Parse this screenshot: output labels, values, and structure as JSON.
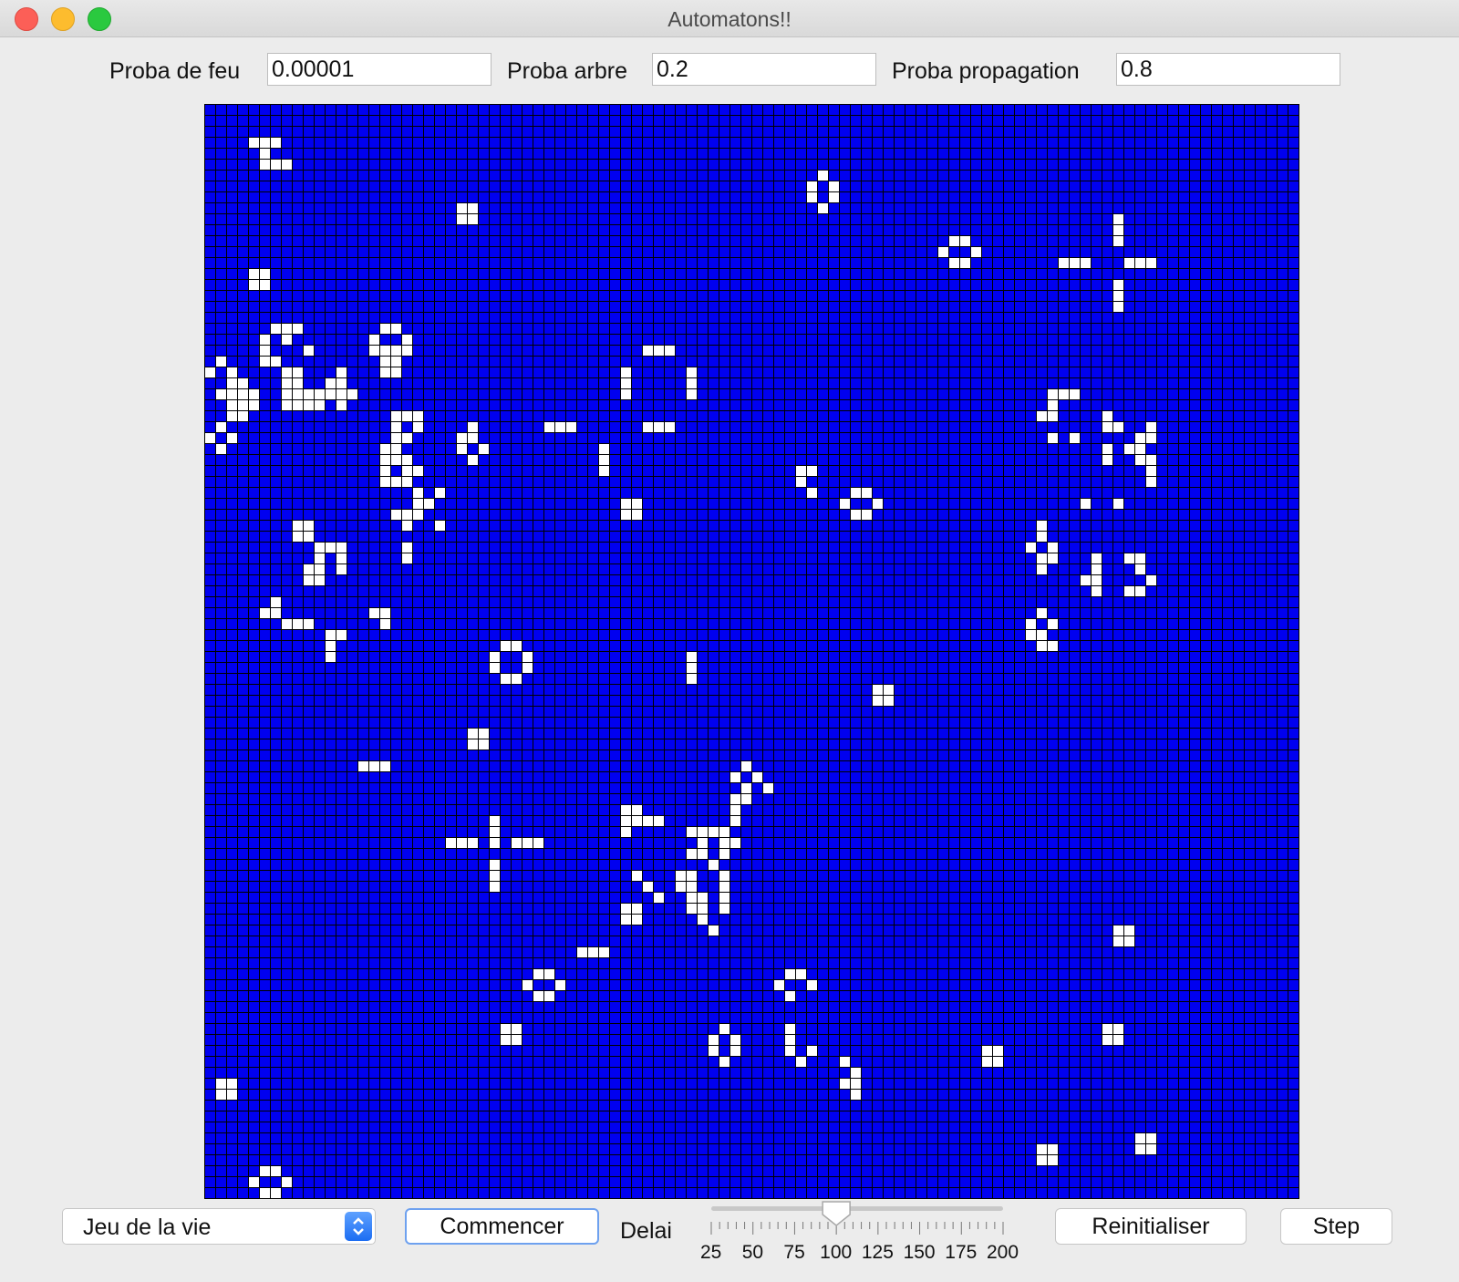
{
  "window": {
    "title": "Automatons!!"
  },
  "params": {
    "fire": {
      "label": "Proba de feu",
      "value": "0.00001"
    },
    "tree": {
      "label": "Proba arbre",
      "value": "0.2"
    },
    "spread": {
      "label": "Proba propagation",
      "value": "0.8"
    }
  },
  "grid": {
    "rows": 100,
    "cols": 100,
    "background_color": "#0000f0",
    "cell_color": "#ffffff",
    "line_color": "#000000",
    "alive_cells": [
      [
        3,
        4
      ],
      [
        3,
        5
      ],
      [
        3,
        6
      ],
      [
        4,
        5
      ],
      [
        5,
        5
      ],
      [
        5,
        6
      ],
      [
        5,
        7
      ],
      [
        6,
        56
      ],
      [
        7,
        55
      ],
      [
        7,
        57
      ],
      [
        8,
        55
      ],
      [
        8,
        57
      ],
      [
        9,
        56
      ],
      [
        9,
        23
      ],
      [
        9,
        24
      ],
      [
        10,
        23
      ],
      [
        10,
        24
      ],
      [
        10,
        83
      ],
      [
        11,
        83
      ],
      [
        12,
        83
      ],
      [
        12,
        68
      ],
      [
        12,
        69
      ],
      [
        13,
        67
      ],
      [
        13,
        70
      ],
      [
        14,
        68
      ],
      [
        14,
        69
      ],
      [
        14,
        78
      ],
      [
        14,
        79
      ],
      [
        14,
        80
      ],
      [
        14,
        84
      ],
      [
        14,
        85
      ],
      [
        14,
        86
      ],
      [
        15,
        4
      ],
      [
        15,
        5
      ],
      [
        16,
        4
      ],
      [
        16,
        5
      ],
      [
        16,
        83
      ],
      [
        17,
        83
      ],
      [
        18,
        83
      ],
      [
        20,
        6
      ],
      [
        20,
        7
      ],
      [
        20,
        8
      ],
      [
        21,
        5
      ],
      [
        21,
        7
      ],
      [
        22,
        5
      ],
      [
        22,
        9
      ],
      [
        23,
        5
      ],
      [
        23,
        6
      ],
      [
        20,
        16
      ],
      [
        20,
        17
      ],
      [
        21,
        15
      ],
      [
        21,
        18
      ],
      [
        22,
        15
      ],
      [
        22,
        16
      ],
      [
        22,
        17
      ],
      [
        22,
        18
      ],
      [
        23,
        16
      ],
      [
        23,
        17
      ],
      [
        24,
        16
      ],
      [
        24,
        17
      ],
      [
        22,
        40
      ],
      [
        22,
        41
      ],
      [
        22,
        42
      ],
      [
        24,
        7
      ],
      [
        24,
        8
      ],
      [
        25,
        7
      ],
      [
        25,
        8
      ],
      [
        25,
        11
      ],
      [
        26,
        7
      ],
      [
        26,
        8
      ],
      [
        26,
        9
      ],
      [
        26,
        10
      ],
      [
        26,
        11
      ],
      [
        26,
        12
      ],
      [
        26,
        13
      ],
      [
        25,
        12
      ],
      [
        24,
        12
      ],
      [
        27,
        7
      ],
      [
        27,
        8
      ],
      [
        27,
        9
      ],
      [
        27,
        10
      ],
      [
        27,
        12
      ],
      [
        23,
        1
      ],
      [
        24,
        0
      ],
      [
        24,
        2
      ],
      [
        25,
        2
      ],
      [
        25,
        3
      ],
      [
        26,
        1
      ],
      [
        26,
        2
      ],
      [
        26,
        3
      ],
      [
        26,
        4
      ],
      [
        27,
        2
      ],
      [
        27,
        3
      ],
      [
        27,
        4
      ],
      [
        28,
        2
      ],
      [
        28,
        3
      ],
      [
        29,
        1
      ],
      [
        30,
        0
      ],
      [
        30,
        2
      ],
      [
        31,
        1
      ],
      [
        24,
        38
      ],
      [
        25,
        38
      ],
      [
        26,
        38
      ],
      [
        24,
        44
      ],
      [
        25,
        44
      ],
      [
        26,
        44
      ],
      [
        26,
        77
      ],
      [
        26,
        78
      ],
      [
        26,
        79
      ],
      [
        27,
        77
      ],
      [
        28,
        76
      ],
      [
        28,
        77
      ],
      [
        28,
        82
      ],
      [
        29,
        82
      ],
      [
        29,
        83
      ],
      [
        29,
        40
      ],
      [
        29,
        41
      ],
      [
        29,
        42
      ],
      [
        28,
        17
      ],
      [
        28,
        18
      ],
      [
        28,
        19
      ],
      [
        29,
        17
      ],
      [
        29,
        19
      ],
      [
        30,
        17
      ],
      [
        30,
        18
      ],
      [
        31,
        16
      ],
      [
        31,
        17
      ],
      [
        32,
        16
      ],
      [
        32,
        17
      ],
      [
        29,
        24
      ],
      [
        30,
        24
      ],
      [
        31,
        25
      ],
      [
        30,
        23
      ],
      [
        31,
        23
      ],
      [
        32,
        24
      ],
      [
        29,
        31
      ],
      [
        29,
        32
      ],
      [
        29,
        33
      ],
      [
        30,
        77
      ],
      [
        30,
        79
      ],
      [
        31,
        82
      ],
      [
        32,
        82
      ],
      [
        29,
        86
      ],
      [
        30,
        85
      ],
      [
        30,
        86
      ],
      [
        31,
        84
      ],
      [
        31,
        85
      ],
      [
        32,
        85
      ],
      [
        32,
        86
      ],
      [
        33,
        86
      ],
      [
        34,
        86
      ],
      [
        31,
        36
      ],
      [
        32,
        36
      ],
      [
        33,
        36
      ],
      [
        33,
        16
      ],
      [
        34,
        16
      ],
      [
        34,
        17
      ],
      [
        34,
        18
      ],
      [
        35,
        19
      ],
      [
        35,
        21
      ],
      [
        36,
        19
      ],
      [
        36,
        20
      ],
      [
        37,
        17
      ],
      [
        37,
        18
      ],
      [
        37,
        19
      ],
      [
        38,
        18
      ],
      [
        38,
        21
      ],
      [
        33,
        18
      ],
      [
        32,
        18
      ],
      [
        33,
        19
      ],
      [
        33,
        54
      ],
      [
        33,
        55
      ],
      [
        34,
        54
      ],
      [
        35,
        55
      ],
      [
        35,
        59
      ],
      [
        35,
        60
      ],
      [
        36,
        58
      ],
      [
        36,
        61
      ],
      [
        37,
        59
      ],
      [
        37,
        60
      ],
      [
        36,
        38
      ],
      [
        36,
        39
      ],
      [
        37,
        38
      ],
      [
        37,
        39
      ],
      [
        36,
        80
      ],
      [
        36,
        83
      ],
      [
        38,
        8
      ],
      [
        38,
        9
      ],
      [
        39,
        8
      ],
      [
        39,
        9
      ],
      [
        38,
        76
      ],
      [
        39,
        76
      ],
      [
        40,
        75
      ],
      [
        40,
        77
      ],
      [
        41,
        76
      ],
      [
        41,
        77
      ],
      [
        42,
        76
      ],
      [
        40,
        10
      ],
      [
        40,
        11
      ],
      [
        40,
        12
      ],
      [
        41,
        10
      ],
      [
        41,
        12
      ],
      [
        42,
        9
      ],
      [
        42,
        10
      ],
      [
        42,
        12
      ],
      [
        43,
        9
      ],
      [
        43,
        10
      ],
      [
        40,
        18
      ],
      [
        41,
        18
      ],
      [
        41,
        81
      ],
      [
        42,
        81
      ],
      [
        43,
        80
      ],
      [
        43,
        81
      ],
      [
        44,
        81
      ],
      [
        41,
        84
      ],
      [
        41,
        85
      ],
      [
        42,
        85
      ],
      [
        43,
        86
      ],
      [
        44,
        84
      ],
      [
        44,
        85
      ],
      [
        45,
        6
      ],
      [
        46,
        5
      ],
      [
        46,
        6
      ],
      [
        47,
        7
      ],
      [
        47,
        8
      ],
      [
        47,
        9
      ],
      [
        48,
        11
      ],
      [
        48,
        12
      ],
      [
        49,
        11
      ],
      [
        50,
        11
      ],
      [
        46,
        15
      ],
      [
        46,
        16
      ],
      [
        47,
        16
      ],
      [
        46,
        76
      ],
      [
        47,
        75
      ],
      [
        47,
        77
      ],
      [
        48,
        75
      ],
      [
        48,
        76
      ],
      [
        49,
        76
      ],
      [
        49,
        77
      ],
      [
        49,
        27
      ],
      [
        49,
        28
      ],
      [
        50,
        26
      ],
      [
        50,
        29
      ],
      [
        51,
        26
      ],
      [
        51,
        29
      ],
      [
        52,
        27
      ],
      [
        52,
        28
      ],
      [
        50,
        44
      ],
      [
        51,
        44
      ],
      [
        52,
        44
      ],
      [
        53,
        61
      ],
      [
        53,
        62
      ],
      [
        54,
        61
      ],
      [
        54,
        62
      ],
      [
        57,
        24
      ],
      [
        57,
        25
      ],
      [
        58,
        24
      ],
      [
        58,
        25
      ],
      [
        60,
        14
      ],
      [
        60,
        15
      ],
      [
        60,
        16
      ],
      [
        60,
        49
      ],
      [
        61,
        48
      ],
      [
        61,
        50
      ],
      [
        62,
        49
      ],
      [
        62,
        51
      ],
      [
        63,
        48
      ],
      [
        63,
        49
      ],
      [
        64,
        38
      ],
      [
        65,
        38
      ],
      [
        66,
        38
      ],
      [
        64,
        39
      ],
      [
        65,
        39
      ],
      [
        65,
        40
      ],
      [
        65,
        41
      ],
      [
        66,
        44
      ],
      [
        66,
        45
      ],
      [
        67,
        45
      ],
      [
        67,
        47
      ],
      [
        66,
        46
      ],
      [
        68,
        44
      ],
      [
        68,
        45
      ],
      [
        64,
        48
      ],
      [
        65,
        48
      ],
      [
        66,
        47
      ],
      [
        67,
        48
      ],
      [
        68,
        47
      ],
      [
        69,
        46
      ],
      [
        65,
        26
      ],
      [
        66,
        26
      ],
      [
        67,
        26
      ],
      [
        67,
        22
      ],
      [
        67,
        23
      ],
      [
        67,
        24
      ],
      [
        67,
        28
      ],
      [
        67,
        29
      ],
      [
        67,
        30
      ],
      [
        69,
        26
      ],
      [
        70,
        26
      ],
      [
        71,
        26
      ],
      [
        70,
        39
      ],
      [
        71,
        40
      ],
      [
        72,
        41
      ],
      [
        70,
        43
      ],
      [
        70,
        44
      ],
      [
        71,
        43
      ],
      [
        71,
        44
      ],
      [
        72,
        44
      ],
      [
        72,
        45
      ],
      [
        73,
        44
      ],
      [
        73,
        45
      ],
      [
        74,
        45
      ],
      [
        75,
        46
      ],
      [
        73,
        47
      ],
      [
        72,
        47
      ],
      [
        71,
        47
      ],
      [
        70,
        47
      ],
      [
        73,
        38
      ],
      [
        73,
        39
      ],
      [
        74,
        38
      ],
      [
        74,
        39
      ],
      [
        75,
        83
      ],
      [
        75,
        84
      ],
      [
        76,
        83
      ],
      [
        76,
        84
      ],
      [
        77,
        34
      ],
      [
        77,
        35
      ],
      [
        77,
        36
      ],
      [
        79,
        30
      ],
      [
        79,
        31
      ],
      [
        80,
        29
      ],
      [
        80,
        32
      ],
      [
        81,
        30
      ],
      [
        81,
        31
      ],
      [
        79,
        53
      ],
      [
        79,
        54
      ],
      [
        80,
        52
      ],
      [
        80,
        55
      ],
      [
        81,
        53
      ],
      [
        84,
        27
      ],
      [
        84,
        28
      ],
      [
        85,
        27
      ],
      [
        85,
        28
      ],
      [
        84,
        47
      ],
      [
        85,
        46
      ],
      [
        85,
        48
      ],
      [
        86,
        46
      ],
      [
        86,
        48
      ],
      [
        87,
        47
      ],
      [
        84,
        53
      ],
      [
        85,
        53
      ],
      [
        86,
        53
      ],
      [
        86,
        55
      ],
      [
        87,
        54
      ],
      [
        84,
        82
      ],
      [
        84,
        83
      ],
      [
        85,
        82
      ],
      [
        85,
        83
      ],
      [
        86,
        71
      ],
      [
        86,
        72
      ],
      [
        87,
        71
      ],
      [
        87,
        72
      ],
      [
        87,
        58
      ],
      [
        88,
        59
      ],
      [
        89,
        58
      ],
      [
        89,
        59
      ],
      [
        90,
        59
      ],
      [
        89,
        1
      ],
      [
        89,
        2
      ],
      [
        90,
        1
      ],
      [
        90,
        2
      ],
      [
        94,
        85
      ],
      [
        94,
        86
      ],
      [
        95,
        85
      ],
      [
        95,
        86
      ],
      [
        95,
        76
      ],
      [
        95,
        77
      ],
      [
        96,
        76
      ],
      [
        96,
        77
      ],
      [
        97,
        5
      ],
      [
        97,
        6
      ],
      [
        98,
        4
      ],
      [
        98,
        7
      ],
      [
        99,
        5
      ],
      [
        99,
        6
      ]
    ]
  },
  "controls": {
    "mode_value": "Jeu de la vie",
    "start_label": "Commencer",
    "delay_label": "Delai",
    "delay_value": 100,
    "delay_min": 25,
    "delay_max": 200,
    "delay_ticks": [
      "25",
      "50",
      "75",
      "100",
      "125",
      "150",
      "175",
      "200"
    ],
    "reset_label": "Reinitialiser",
    "step_label": "Step"
  }
}
